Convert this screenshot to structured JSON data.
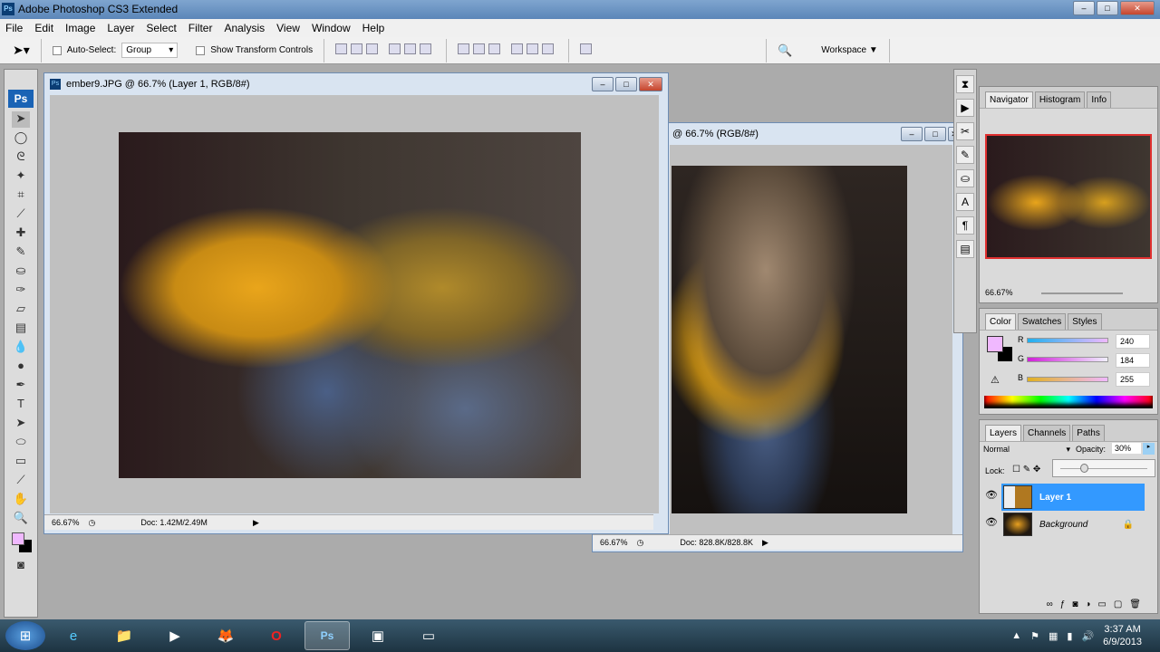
{
  "window": {
    "title": "Adobe Photoshop CS3 Extended",
    "app_icon": "Ps"
  },
  "menu": [
    "File",
    "Edit",
    "Image",
    "Layer",
    "Select",
    "Filter",
    "Analysis",
    "View",
    "Window",
    "Help"
  ],
  "options": {
    "auto_select_label": "Auto-Select:",
    "auto_select_value": "Group",
    "transform_label": "Show Transform Controls",
    "workspace_label": "Workspace ▼"
  },
  "toolbox": {
    "logo": "Ps"
  },
  "doc1": {
    "title": "ember9.JPG @ 66.7% (Layer 1, RGB/8#)",
    "zoom": "66.67%",
    "doc": "Doc: 1.42M/2.49M"
  },
  "doc2": {
    "title": "@ 66.7% (RGB/8#)",
    "zoom": "66.67%",
    "doc": "Doc: 828.8K/828.8K"
  },
  "navigator": {
    "tabs": [
      "Navigator",
      "Histogram",
      "Info"
    ],
    "zoom": "66.67%"
  },
  "color": {
    "tabs": [
      "Color",
      "Swatches",
      "Styles"
    ],
    "channels": [
      {
        "label": "R",
        "value": "240"
      },
      {
        "label": "G",
        "value": "184"
      },
      {
        "label": "B",
        "value": "255"
      }
    ],
    "foreground": "#f0b8ff",
    "background": "#000000"
  },
  "layers": {
    "tabs": [
      "Layers",
      "Channels",
      "Paths"
    ],
    "blend_mode": "Normal",
    "opacity_label": "Opacity:",
    "opacity": "30%",
    "lock_label": "Lock:",
    "items": [
      {
        "name": "Layer 1",
        "selected": true
      },
      {
        "name": "Background",
        "locked": true
      }
    ]
  },
  "taskbar": {
    "time": "3:37 AM",
    "date": "6/9/2013"
  }
}
